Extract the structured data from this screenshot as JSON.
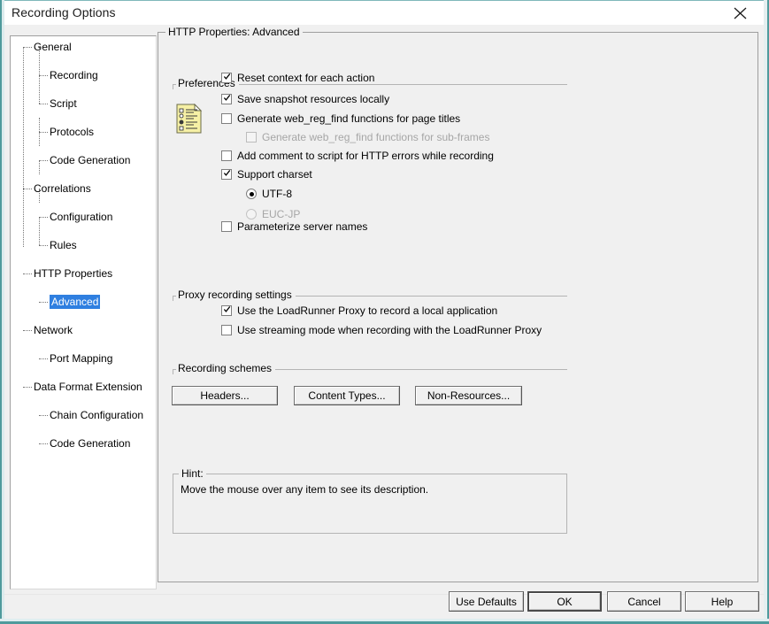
{
  "window": {
    "title": "Recording Options",
    "close_icon": "close-icon",
    "accent_border": "#4f9a9c"
  },
  "tree": {
    "items": [
      {
        "label": "General",
        "level": 1,
        "selected": false
      },
      {
        "label": "Recording",
        "level": 2,
        "selected": false
      },
      {
        "label": "Script",
        "level": 2,
        "selected": false
      },
      {
        "label": "Protocols",
        "level": 2,
        "selected": false
      },
      {
        "label": "Code Generation",
        "level": 2,
        "selected": false
      },
      {
        "label": "Correlations",
        "level": 1,
        "selected": false
      },
      {
        "label": "Configuration",
        "level": 2,
        "selected": false
      },
      {
        "label": "Rules",
        "level": 2,
        "selected": false
      },
      {
        "label": "HTTP Properties",
        "level": 1,
        "selected": false
      },
      {
        "label": "Advanced",
        "level": 2,
        "selected": true
      },
      {
        "label": "Network",
        "level": 1,
        "selected": false
      },
      {
        "label": "Port Mapping",
        "level": 2,
        "selected": false
      },
      {
        "label": "Data Format Extension",
        "level": 1,
        "selected": false
      },
      {
        "label": "Chain Configuration",
        "level": 2,
        "selected": false
      },
      {
        "label": "Code Generation",
        "level": 2,
        "selected": false
      }
    ],
    "selection_color": "#2f7fe0"
  },
  "panel": {
    "title": "HTTP Properties: Advanced",
    "preferences": {
      "title": "Preferences",
      "icon": "options-document-icon",
      "options": [
        {
          "label": "Reset context for each action",
          "checked": true,
          "disabled": false,
          "indent": 0
        },
        {
          "label": "Save snapshot resources locally",
          "checked": true,
          "disabled": false,
          "indent": 0
        },
        {
          "label": "Generate web_reg_find functions for page titles",
          "checked": false,
          "disabled": false,
          "indent": 0
        },
        {
          "label": "Generate web_reg_find functions for sub-frames",
          "checked": false,
          "disabled": true,
          "indent": 1
        },
        {
          "label": "Add comment to script for HTTP errors while recording",
          "checked": false,
          "disabled": false,
          "indent": 0
        },
        {
          "label": "Support charset",
          "checked": true,
          "disabled": false,
          "indent": 0
        }
      ],
      "charset_radios": [
        {
          "label": "UTF-8",
          "selected": true,
          "disabled": false
        },
        {
          "label": "EUC-JP",
          "selected": false,
          "disabled": true
        }
      ],
      "trailing_options": [
        {
          "label": "Parameterize server names",
          "checked": false,
          "disabled": false,
          "indent": 0
        }
      ]
    },
    "proxy": {
      "title": "Proxy recording settings",
      "options": [
        {
          "label": "Use the LoadRunner Proxy to record a local application",
          "checked": true,
          "disabled": false
        },
        {
          "label": "Use streaming mode when recording with the LoadRunner Proxy",
          "checked": false,
          "disabled": false
        }
      ]
    },
    "schemes": {
      "title": "Recording schemes",
      "buttons": [
        {
          "label": "Headers..."
        },
        {
          "label": "Content Types..."
        },
        {
          "label": "Non-Resources..."
        }
      ]
    },
    "hint": {
      "title": "Hint:",
      "text": "Move the mouse over any item to see its description."
    }
  },
  "footer": {
    "buttons": [
      {
        "label": "Use Defaults",
        "default": false
      },
      {
        "label": "OK",
        "default": true
      },
      {
        "label": "Cancel",
        "default": false
      },
      {
        "label": "Help",
        "default": false
      }
    ]
  }
}
